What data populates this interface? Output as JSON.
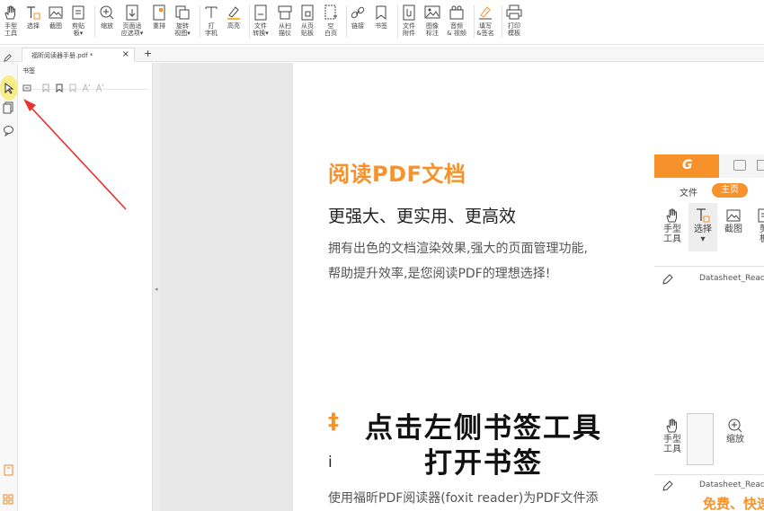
{
  "ribbon": {
    "tools": [
      {
        "label": "手型\n工具",
        "icon": "hand-icon"
      },
      {
        "label": "选择",
        "icon": "select-text-icon"
      },
      {
        "label": "截图",
        "icon": "screenshot-icon"
      },
      {
        "label": "剪贴\n板▾",
        "icon": "clipboard-icon"
      },
      {
        "label": "缩放",
        "icon": "zoom-icon"
      },
      {
        "label": "页面适\n应选项▾",
        "icon": "fit-page-icon"
      },
      {
        "label": "重排",
        "icon": "reflow-icon"
      },
      {
        "label": "旋转\n视图▾",
        "icon": "rotate-icon"
      },
      {
        "label": "打\n字机",
        "icon": "typewriter-icon"
      },
      {
        "label": "高亮",
        "icon": "highlight-icon"
      },
      {
        "label": "文件\n转换▾",
        "icon": "file-convert-icon"
      },
      {
        "label": "从扫\n描仪",
        "icon": "scanner-icon"
      },
      {
        "label": "从页\n贴板",
        "icon": "from-clipboard-icon"
      },
      {
        "label": "空\n白页",
        "icon": "blank-page-icon"
      },
      {
        "label": "链接",
        "icon": "link-icon"
      },
      {
        "label": "书签",
        "icon": "bookmark-icon"
      },
      {
        "label": "文件\n附件",
        "icon": "attachment-icon"
      },
      {
        "label": "图像\n标注",
        "icon": "image-annotation-icon"
      },
      {
        "label": "音频\n& 视频",
        "icon": "audio-video-icon"
      },
      {
        "label": "填写\n&签名",
        "icon": "sign-icon"
      },
      {
        "label": "打印\n模板",
        "icon": "print-icon"
      }
    ]
  },
  "tabbar": {
    "doc_tab_label": "福昕阅读器手册.pdf *",
    "close_glyph": "×",
    "add_glyph": "+"
  },
  "panel": {
    "title": "书签"
  },
  "page": {
    "heading": "阅读PDF文档",
    "subheading": "更强大、更实用、更高效",
    "body_line1": "拥有出色的文档渲染效果,强大的页面管理功能,",
    "body_line2": "帮助提升效率,是您阅读PDF的理想选择!",
    "section2_heading_partial": "‡",
    "section2_sub_partial": "i",
    "section2_body": "使用福昕PDF阅读器(foxit reader)为PDF文件添"
  },
  "shot1": {
    "logo": "G",
    "tab_file": "文件",
    "tab_home": "主页",
    "tools": [
      {
        "label": "手型\n工具"
      },
      {
        "label": "选择\n▾"
      },
      {
        "label": "截图"
      },
      {
        "label": "剪\n板"
      }
    ],
    "address": "Datasheet_Read"
  },
  "shot2": {
    "tools": [
      {
        "label": "手型\n工具"
      },
      {
        "label": "缩放"
      }
    ],
    "address": "Datasheet_Read",
    "promo": "免费、快速"
  },
  "caption": {
    "line1": "点击左侧书签工具",
    "line2": "打开书签"
  },
  "colors": {
    "accent": "#f7922b",
    "arrow": "#e8332f",
    "highlight": "#f7ee8a"
  }
}
